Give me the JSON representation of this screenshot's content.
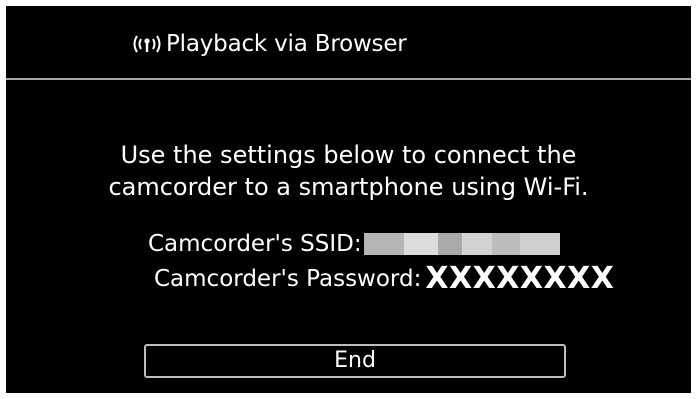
{
  "header": {
    "title": "Playback via Browser",
    "icon": "wifi-broadcast-icon"
  },
  "instructions": {
    "line1": "Use the settings below to connect the",
    "line2": "camcorder to a smartphone using Wi-Fi."
  },
  "ssid": {
    "label": "Camcorder's SSID:",
    "value_obscured": true
  },
  "password": {
    "label": "Camcorder's Password:",
    "value": "XXXXXXXX"
  },
  "actions": {
    "end_label": "End"
  },
  "colors": {
    "background": "#000000",
    "text": "#ffffff",
    "divider": "#a8a8a8",
    "button_border": "#bdbdbd"
  }
}
